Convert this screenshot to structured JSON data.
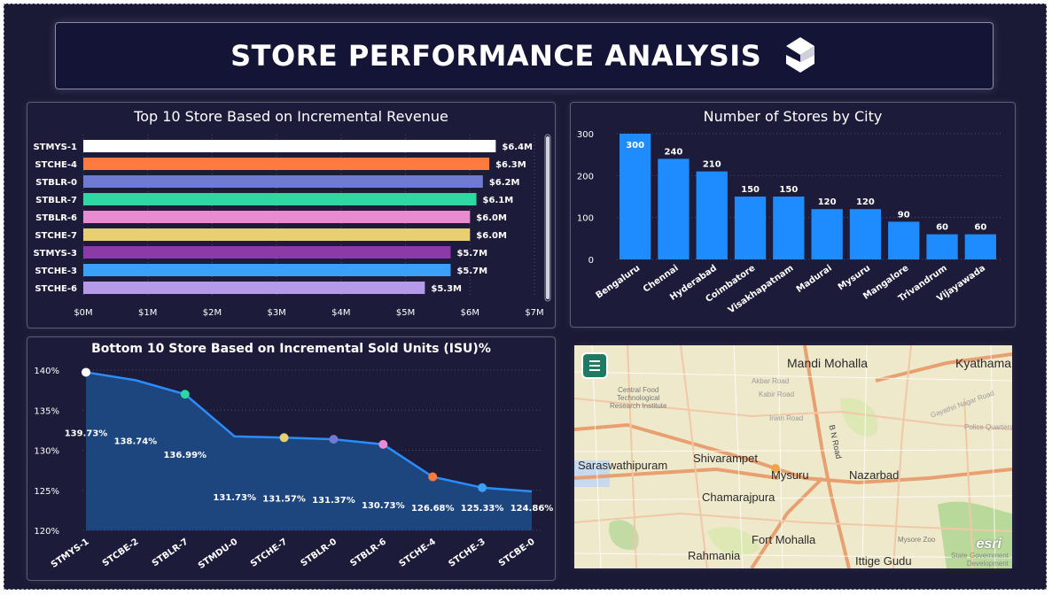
{
  "header": {
    "title": "STORE PERFORMANCE ANALYSIS",
    "logo_icon": "stacked-layers-logo-icon"
  },
  "colors": {
    "background": "#1a1a36",
    "bar_blue": "#1e8cff",
    "area_fill": "#1e4a86"
  },
  "top_stores": {
    "title": "Top 10 Store Based on Incremental Revenue",
    "chart_data": {
      "type": "bar",
      "orientation": "horizontal",
      "categories": [
        "STMYS-1",
        "STCHE-4",
        "STBLR-0",
        "STBLR-7",
        "STBLR-6",
        "STCHE-7",
        "STMYS-3",
        "STCHE-3",
        "STCHE-6"
      ],
      "values": [
        6.4,
        6.3,
        6.2,
        6.1,
        6.0,
        6.0,
        5.7,
        5.7,
        5.3
      ],
      "value_labels": [
        "$6.4M",
        "$6.3M",
        "$6.2M",
        "$6.1M",
        "$6.0M",
        "$6.0M",
        "$5.7M",
        "$5.7M",
        "$5.3M"
      ],
      "colors": [
        "#ffffff",
        "#ff7a3c",
        "#6f7bd0",
        "#2fd8a0",
        "#ea8ad0",
        "#e8d072",
        "#8b3aa8",
        "#3aa0f8",
        "#b49ae8"
      ],
      "xlim": [
        0,
        7
      ],
      "xticks": [
        "$0M",
        "$1M",
        "$2M",
        "$3M",
        "$4M",
        "$5M",
        "$6M",
        "$7M"
      ]
    }
  },
  "city_stores": {
    "title": "Number of Stores by City",
    "chart_data": {
      "type": "bar",
      "categories": [
        "Bengaluru",
        "Chennai",
        "Hyderabad",
        "Coimbatore",
        "Visakhapatnam",
        "Madurai",
        "Mysuru",
        "Mangalore",
        "Trivandrum",
        "Vijayawada"
      ],
      "values": [
        300,
        240,
        210,
        150,
        150,
        120,
        120,
        90,
        60,
        60
      ],
      "ylim": [
        0,
        300
      ],
      "yticks": [
        "0",
        "100",
        "200",
        "300"
      ]
    }
  },
  "bottom_stores": {
    "title": "Bottom 10 Store Based on Incremental Sold Units (ISU)%",
    "chart_data": {
      "type": "area",
      "categories": [
        "STMYS-1",
        "STCBE-2",
        "STBLR-7",
        "STMDU-0",
        "STCHE-7",
        "STBLR-0",
        "STBLR-6",
        "STCHE-4",
        "STCHE-3",
        "STCBE-0"
      ],
      "values": [
        139.73,
        138.74,
        136.99,
        131.73,
        131.57,
        131.37,
        130.73,
        126.68,
        125.33,
        124.86
      ],
      "value_labels": [
        "139.73%",
        "138.74%",
        "136.99%",
        "131.73%",
        "131.57%",
        "131.37%",
        "130.73%",
        "126.68%",
        "125.33%",
        "124.86%"
      ],
      "marker_colors": [
        "#ffffff",
        null,
        "#2fd8a0",
        null,
        "#e8d072",
        "#6f7bd0",
        "#ea8ad0",
        "#ff7a3c",
        "#3aa0f8",
        null
      ],
      "ylim": [
        120,
        140
      ],
      "yticks": [
        "120%",
        "125%",
        "130%",
        "135%",
        "140%"
      ]
    }
  },
  "map": {
    "menu_icon": "hamburger-menu-icon",
    "labels": {
      "mandi": "Mandi Mohalla",
      "kyathama": "Kyathama",
      "cftri": "Central Food\nTechnological\nResearch Institute",
      "saraswathipuram": "Saraswathipuram",
      "shivarampet": "Shivarampet",
      "mysuru": "Mysuru",
      "nazarbad": "Nazarbad",
      "chamarajpura": "Chamarajpura",
      "fort": "Fort Mohalla",
      "rahmania": "Rahmania",
      "ittige": "Ittige Gudu",
      "zoo": "Mysore Zoo",
      "bn_road": "B N Road",
      "akbar": "Akbar Road",
      "irwin": "Irwin Road",
      "kabir": "Kabir Road",
      "gayathri": "Gayathri Nagar Road",
      "police": "Police Quarters"
    },
    "esri": "esri",
    "credit": "State Government\nDevelopment"
  }
}
